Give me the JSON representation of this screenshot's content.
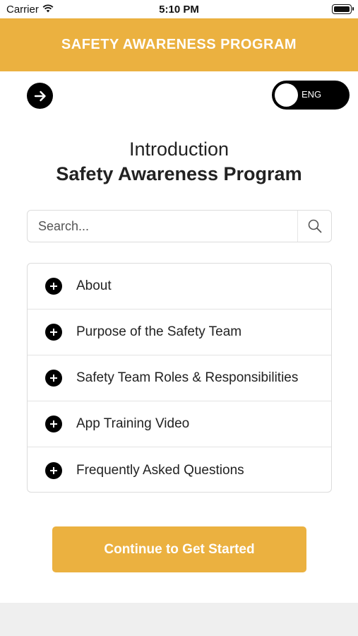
{
  "status_bar": {
    "carrier": "Carrier",
    "time": "5:10 PM"
  },
  "header": {
    "title": "SAFETY AWARENESS PROGRAM",
    "background": "#ebb140"
  },
  "language_toggle": {
    "label": "ENG"
  },
  "intro": {
    "title": "Introduction",
    "subtitle": "Safety Awareness Program"
  },
  "search": {
    "placeholder": "Search...",
    "value": "",
    "icon": "search-icon"
  },
  "accordion": {
    "items": [
      {
        "label": "About",
        "icon": "plus-circle-icon"
      },
      {
        "label": "Purpose of the Safety Team",
        "icon": "plus-circle-icon"
      },
      {
        "label": "Safety Team Roles & Responsibilities",
        "icon": "plus-circle-icon"
      },
      {
        "label": "App Training Video",
        "icon": "plus-circle-icon"
      },
      {
        "label": "Frequently Asked Questions",
        "icon": "plus-circle-icon"
      }
    ]
  },
  "cta": {
    "label": "Continue to Get Started",
    "color": "#ebb140"
  }
}
